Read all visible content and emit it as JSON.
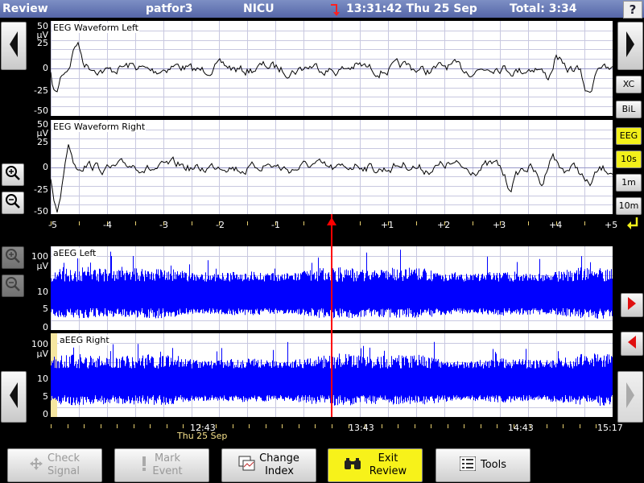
{
  "header": {
    "mode": "Review",
    "patient": "patfor3",
    "unit": "NICU",
    "timestamp": "13:31:42 Thu 25 Sep",
    "total": "Total: 3:34",
    "help_label": "?"
  },
  "eeg_left": {
    "title": "EEG Waveform Left",
    "unit": "µV",
    "y_ticks": [
      "50",
      "25",
      "0",
      "-25",
      "-50"
    ]
  },
  "eeg_right": {
    "title": "EEG Waveform Right",
    "unit": "µV",
    "y_ticks": [
      "50",
      "25",
      "0",
      "-25",
      "-50"
    ]
  },
  "eeg_time_axis": [
    "-5",
    "-4",
    "-3",
    "-2",
    "-1",
    "+1",
    "+2",
    "+3",
    "+4",
    "+5"
  ],
  "aeeg_left": {
    "title": "aEEG Left",
    "unit": "µV",
    "y_ticks": [
      "100",
      "10",
      "5",
      "0"
    ]
  },
  "aeeg_right": {
    "title": "aEEG Right",
    "unit": "µV",
    "y_ticks": [
      "100",
      "10",
      "5",
      "0"
    ]
  },
  "aeeg_time_axis": {
    "t1": "12:43",
    "t1_date": "Thu 25 Sep",
    "t2": "13:43",
    "t3": "14:43",
    "t4": "15:17"
  },
  "side_buttons": {
    "xc": "XC",
    "bil": "BiL",
    "eeg": "EEG",
    "s10": "10s",
    "m1": "1m",
    "m10": "10m"
  },
  "toolbar": {
    "check_signal": "Check\nSignal",
    "mark_event": "Mark\nEvent",
    "change_index": "Change\nIndex",
    "exit_review": "Exit\nReview",
    "tools": "Tools"
  },
  "colors": {
    "header_bg": "#6576b6",
    "waveform": "#000000",
    "aeeg_trace": "#0000ff",
    "cursor": "#ff0000",
    "highlight_button": "#f2f01a",
    "date_label": "#f5e08a"
  }
}
